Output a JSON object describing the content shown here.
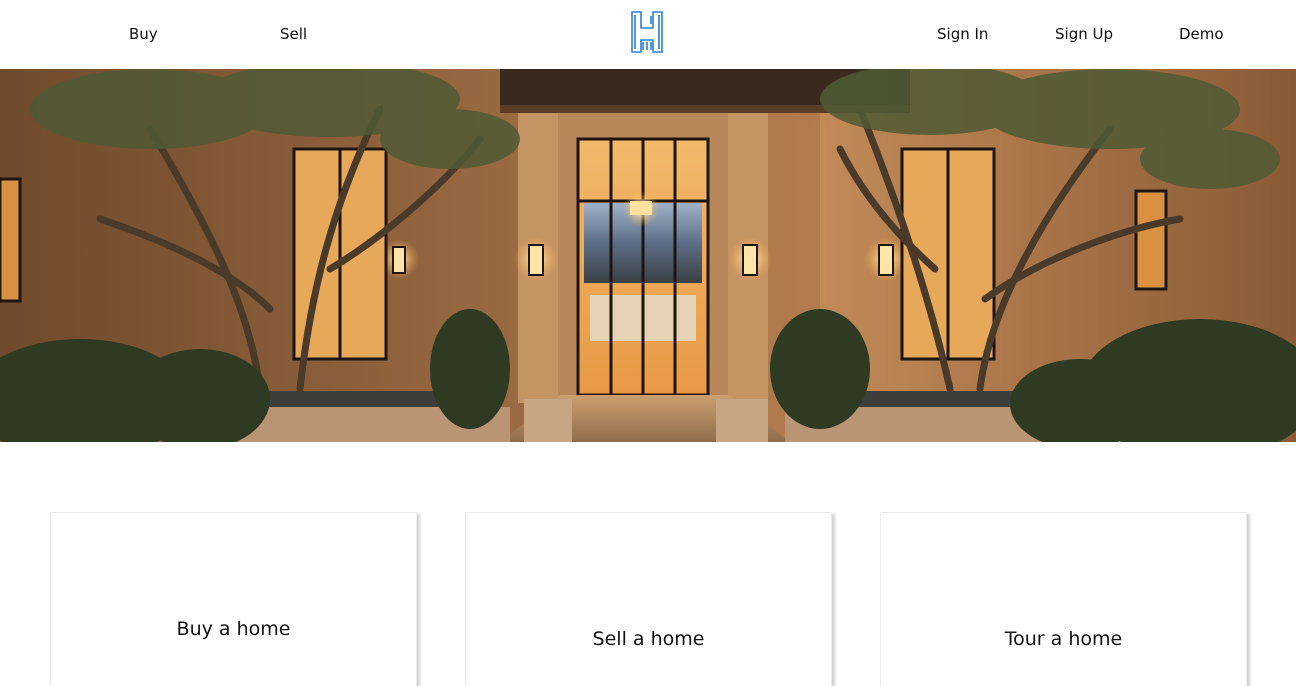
{
  "nav": {
    "left": [
      {
        "label": "Buy"
      },
      {
        "label": "Sell"
      }
    ],
    "right": [
      {
        "label": "Sign In"
      },
      {
        "label": "Sign Up"
      },
      {
        "label": "Demo"
      }
    ],
    "logo_icon": "h-building-logo-icon",
    "accent_color": "#2f7fd8"
  },
  "hero": {
    "image": "luxury-home-courtyard-entrance-at-dusk"
  },
  "cards": [
    {
      "label": "Buy a home"
    },
    {
      "label": "Sell a home"
    },
    {
      "label": "Tour a home"
    }
  ]
}
